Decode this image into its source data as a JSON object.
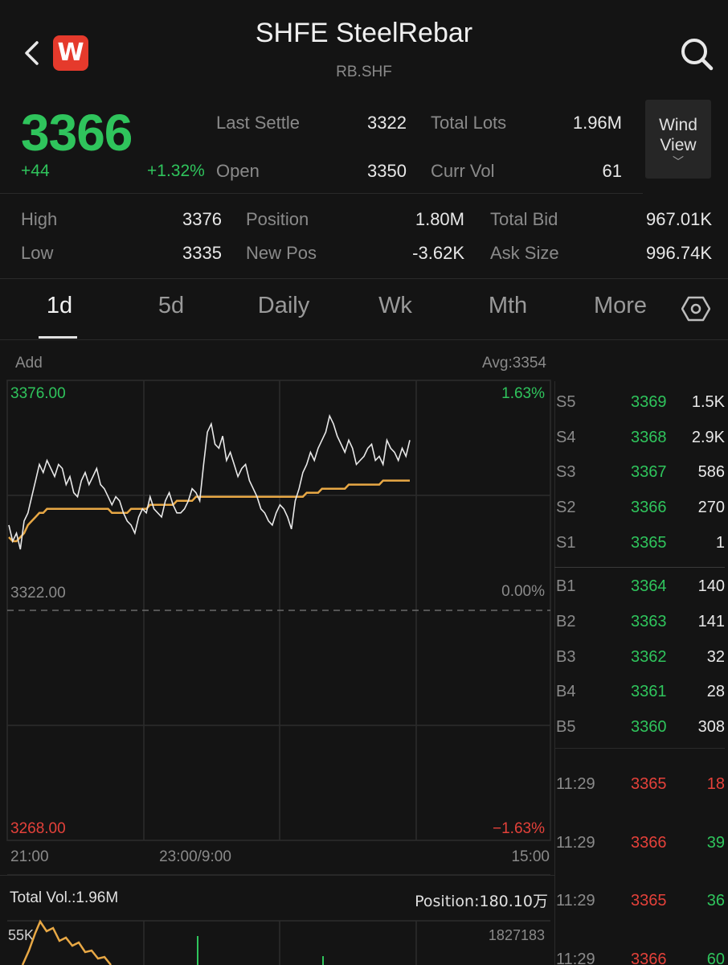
{
  "header": {
    "title": "SHFE SteelRebar",
    "subtitle": "RB.SHF",
    "logo_letter": "W"
  },
  "quote": {
    "price": "3366",
    "change": "+44",
    "change_pct": "+1.32%",
    "last_settle_label": "Last Settle",
    "last_settle": "3322",
    "open_label": "Open",
    "open": "3350",
    "total_lots_label": "Total Lots",
    "total_lots": "1.96M",
    "curr_vol_label": "Curr Vol",
    "curr_vol": "61",
    "high_label": "High",
    "high": "3376",
    "low_label": "Low",
    "low": "3335",
    "position_label": "Position",
    "position": "1.80M",
    "new_pos_label": "New Pos",
    "new_pos": "-3.62K",
    "total_bid_label": "Total Bid",
    "total_bid": "967.01K",
    "ask_size_label": "Ask Size",
    "ask_size": "996.74K",
    "wind_view_line1": "Wind",
    "wind_view_line2": "View"
  },
  "tabs": [
    "1d",
    "5d",
    "Daily",
    "Wk",
    "Mth",
    "More"
  ],
  "active_tab": "1d",
  "chart_header": {
    "add_label": "Add",
    "avg_label": "Avg:3354"
  },
  "chart_data": {
    "type": "line",
    "y_top_label": "3376.00",
    "y_mid_label": "3322.00",
    "y_bottom_label": "3268.00",
    "pct_top_label": "1.63%",
    "pct_mid_label": "0.00%",
    "pct_bottom_label": "−1.63%",
    "x_labels": [
      "21:00",
      "23:00/9:00",
      "15:00"
    ],
    "ylim": [
      3268,
      3376
    ],
    "series": [
      {
        "color": "#e8e8e8",
        "values": [
          3343,
          3339,
          3341,
          3337,
          3344,
          3346,
          3350,
          3354,
          3358,
          3356,
          3359,
          3357,
          3355,
          3358,
          3357,
          3353,
          3355,
          3351,
          3350,
          3354,
          3356,
          3353,
          3355,
          3357,
          3353,
          3352,
          3350,
          3348,
          3350,
          3349,
          3346,
          3344,
          3343,
          3341,
          3345,
          3347,
          3346,
          3350,
          3347,
          3346,
          3345,
          3349,
          3351,
          3348,
          3346,
          3346,
          3347,
          3349,
          3352,
          3351,
          3349,
          3358,
          3366,
          3368,
          3363,
          3362,
          3365,
          3359,
          3361,
          3358,
          3355,
          3357,
          3358,
          3354,
          3352,
          3350,
          3347,
          3346,
          3344,
          3343,
          3346,
          3348,
          3347,
          3345,
          3342,
          3349,
          3352,
          3356,
          3358,
          3361,
          3359,
          3362,
          3364,
          3366,
          3370,
          3368,
          3365,
          3363,
          3361,
          3364,
          3362,
          3358,
          3359,
          3360,
          3362,
          3363,
          3359,
          3360,
          3358,
          3364,
          3362,
          3361,
          3359,
          3362,
          3360,
          3364
        ]
      },
      {
        "color": "#e8a845",
        "values": [
          3340,
          3339,
          3339,
          3340,
          3341,
          3343,
          3344,
          3345,
          3346,
          3346,
          3347,
          3347,
          3347,
          3347,
          3347,
          3347,
          3347,
          3347,
          3347,
          3347,
          3347,
          3347,
          3347,
          3347,
          3347,
          3347,
          3347,
          3346,
          3346,
          3346,
          3346,
          3346,
          3347,
          3347,
          3347,
          3347,
          3347,
          3348,
          3348,
          3348,
          3348,
          3348,
          3348,
          3348,
          3349,
          3349,
          3349,
          3349,
          3349,
          3350,
          3350,
          3350,
          3350,
          3350,
          3350,
          3350,
          3350,
          3350,
          3350,
          3350,
          3350,
          3350,
          3350,
          3350,
          3350,
          3350,
          3350,
          3350,
          3350,
          3350,
          3350,
          3350,
          3350,
          3350,
          3350,
          3350,
          3350,
          3350,
          3351,
          3351,
          3351,
          3351,
          3352,
          3352,
          3352,
          3352,
          3352,
          3352,
          3352,
          3353,
          3353,
          3353,
          3353,
          3353,
          3353,
          3353,
          3353,
          3353,
          3354,
          3354,
          3354,
          3354,
          3354,
          3354,
          3354,
          3354
        ]
      }
    ]
  },
  "order_book": {
    "asks": [
      {
        "label": "S5",
        "price": "3369",
        "vol": "1.5K"
      },
      {
        "label": "S4",
        "price": "3368",
        "vol": "2.9K"
      },
      {
        "label": "S3",
        "price": "3367",
        "vol": "586"
      },
      {
        "label": "S2",
        "price": "3366",
        "vol": "270"
      },
      {
        "label": "S1",
        "price": "3365",
        "vol": "1"
      }
    ],
    "bids": [
      {
        "label": "B1",
        "price": "3364",
        "vol": "140"
      },
      {
        "label": "B2",
        "price": "3363",
        "vol": "141"
      },
      {
        "label": "B3",
        "price": "3362",
        "vol": "32"
      },
      {
        "label": "B4",
        "price": "3361",
        "vol": "28"
      },
      {
        "label": "B5",
        "price": "3360",
        "vol": "308"
      }
    ],
    "ticks": [
      {
        "time": "11:29",
        "price": "3365",
        "vol": "18",
        "side": "sell"
      },
      {
        "time": "11:29",
        "price": "3366",
        "vol": "39",
        "side": "buy"
      },
      {
        "time": "11:29",
        "price": "3365",
        "vol": "36",
        "side": "buy"
      },
      {
        "time": "11:29",
        "price": "3366",
        "vol": "60",
        "side": "buy"
      }
    ]
  },
  "volume_panel": {
    "total_vol": "Total Vol.:1.96M",
    "position": "Position:180.10万",
    "left_axis": "55K",
    "right_axis": "1827183"
  }
}
